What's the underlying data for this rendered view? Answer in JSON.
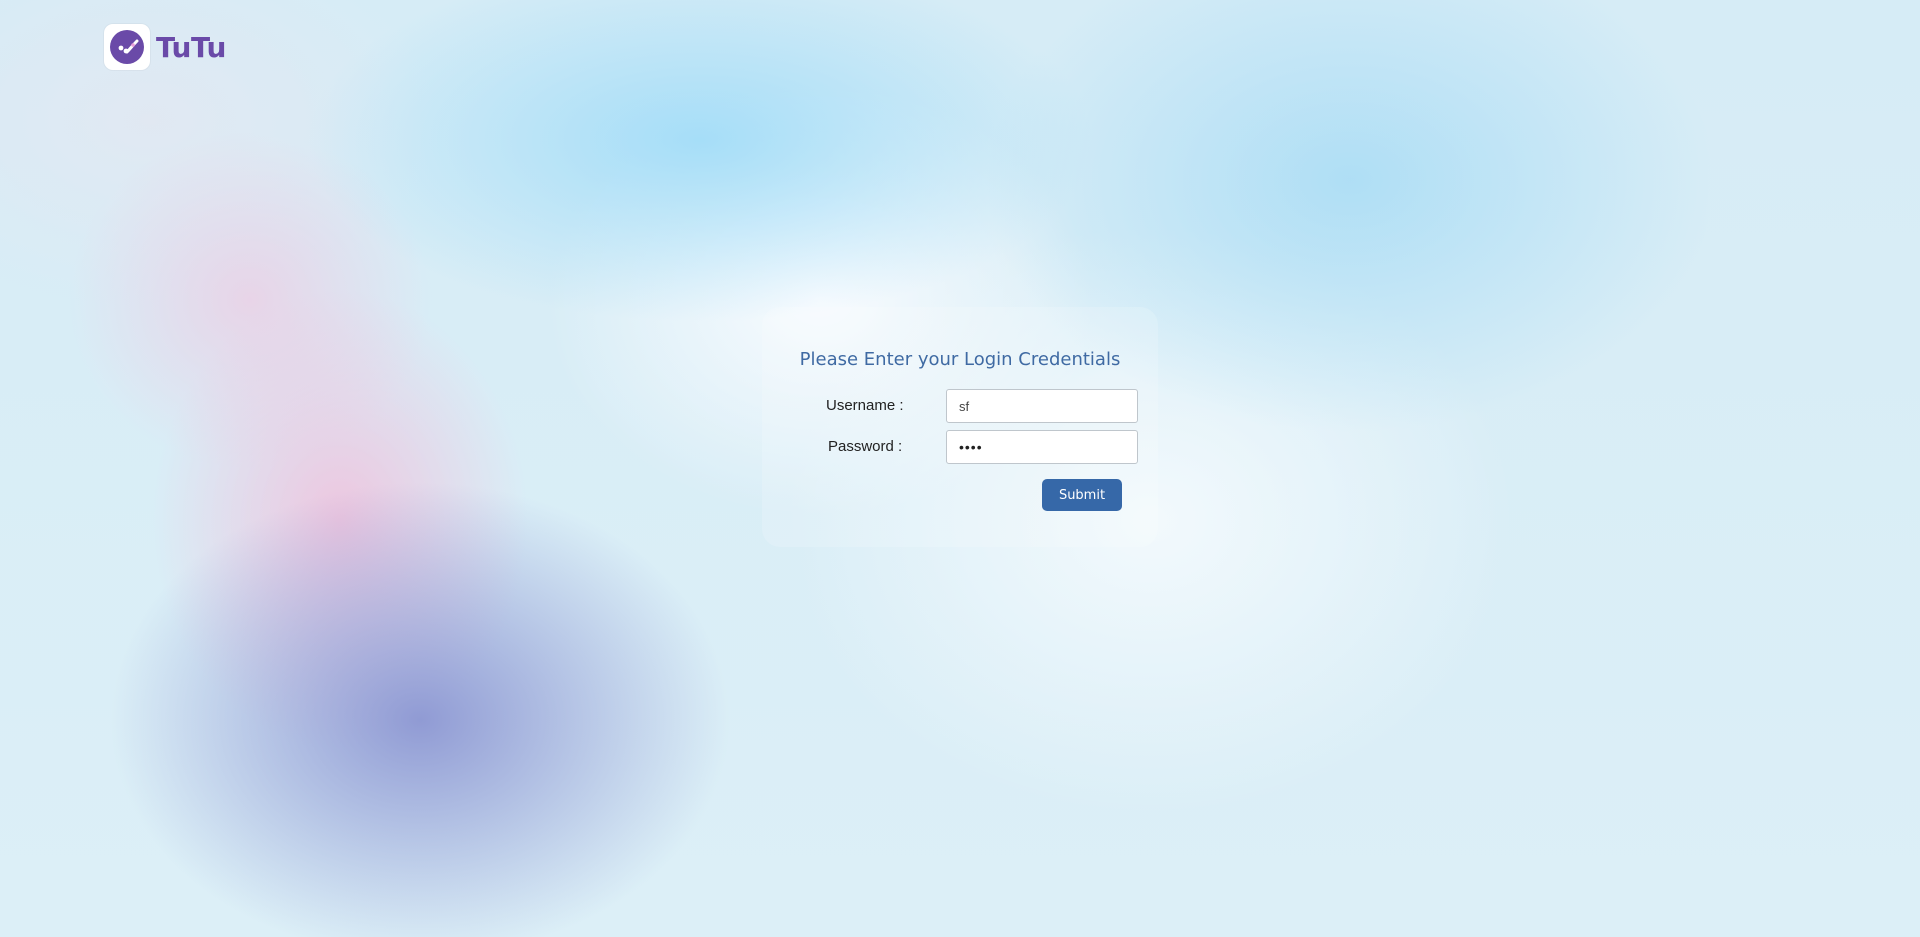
{
  "brand": {
    "name": "TuTu",
    "logo_icon": "tutu-logo-icon",
    "color": "#6a4aa8"
  },
  "login": {
    "title": "Please Enter your Login Credentials",
    "username_label": "Username :",
    "username_value": "sf",
    "password_label": "Password :",
    "password_value": "••••",
    "submit_label": "Submit"
  },
  "colors": {
    "title": "#3f6aa3",
    "button": "#3668a8"
  }
}
